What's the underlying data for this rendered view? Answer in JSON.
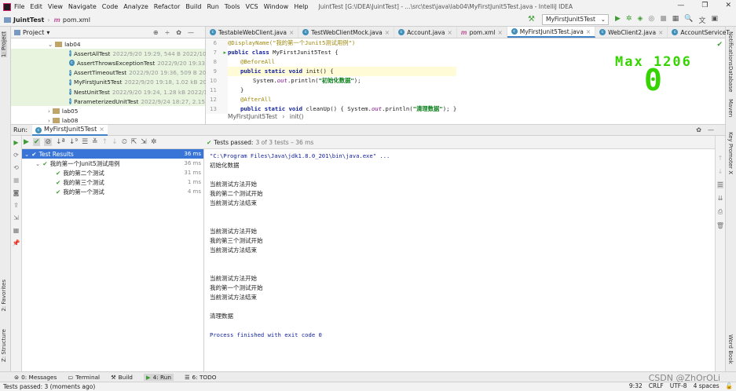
{
  "menubar": {
    "items": [
      "File",
      "Edit",
      "View",
      "Navigate",
      "Code",
      "Analyze",
      "Refactor",
      "Build",
      "Run",
      "Tools",
      "VCS",
      "Window",
      "Help"
    ],
    "title": "JuintTest [G:\\IDEA\\JuintTest] - ...\\src\\test\\java\\lab04\\MyFirstJunit5Test.java - IntelliJ IDEA"
  },
  "navbar": {
    "project": "JuintTest",
    "file": "pom.xml",
    "run_config": "MyFirstJunit5Test"
  },
  "left_tools": {
    "project": "1: Project",
    "favorites": "2: Favorites",
    "structure": "Z: Structure"
  },
  "right_tools": {
    "notifications": "Notifications",
    "database": "Database",
    "maven": "Maven",
    "key_promoter": "Key Promoter X",
    "word_book": "Word Book"
  },
  "project_panel": {
    "header": "Project",
    "rows": [
      {
        "type": "folder",
        "label": "lab04",
        "meta": ""
      },
      {
        "type": "class",
        "label": "AssertAllTest",
        "meta": "2022/9/20 19:29, 544 B 2022/10"
      },
      {
        "type": "class",
        "label": "AssertThrowsExceptionTest",
        "meta": "2022/9/20 19:33"
      },
      {
        "type": "class",
        "label": "AssertTimeoutTest",
        "meta": "2022/9/20 19:36, 509 B 20"
      },
      {
        "type": "class",
        "label": "MyFirstJunit5Test",
        "meta": "2022/9/20 19:18, 1.02 kB 20"
      },
      {
        "type": "class",
        "label": "NestUnitTest",
        "meta": "2022/9/20 19:24, 1.28 kB 2022/10/25 19:26"
      },
      {
        "type": "class",
        "label": "ParameterizedUnitTest",
        "meta": "2022/9/24 18:27, 2.15"
      },
      {
        "type": "folder",
        "label": "lab05",
        "meta": ""
      },
      {
        "type": "folder",
        "label": "lab08",
        "meta": ""
      }
    ]
  },
  "editor": {
    "tabs": [
      "TestableWebClient.java",
      "TestWebClientMock.java",
      "Account.java",
      "pom.xml",
      "MyFirstJunit5Test.java",
      "WebClient2.java",
      "AccountServiceT"
    ],
    "tab_more": "≡4",
    "line_numbers": [
      "6",
      "7",
      "8",
      "9",
      "10",
      "11",
      "12",
      "13"
    ],
    "lines": {
      "l6": "@DisplayName(\"我的第一个Junit5测试用例\")",
      "l7a": "public class ",
      "l7b": "MyFirstJunit5Test {",
      "l8": "@BeforeAll",
      "l9a": "public static void ",
      "l9b": "init() {",
      "l10a": "System.",
      "l10b": "out",
      "l10c": ".println(",
      "l10d": "\"初始化数据\"",
      "l10e": ");",
      "l11": "}",
      "l12": "@AfterAll",
      "l13a": "public static void ",
      "l13b": "cleanUp() { System.",
      "l13c": "out",
      "l13d": ".println(",
      "l13e": "\"清理数据\"",
      "l13f": "); }"
    },
    "breadcrumb": {
      "cls": "MyFirstJunit5Test",
      "method": "init()"
    },
    "overlay_max": "Max 1206",
    "overlay_zero": "0"
  },
  "run": {
    "label": "Run:",
    "tab": "MyFirstJunit5Test",
    "status_bold": "Tests passed:",
    "status_rest": "3 of 3 tests – 36 ms",
    "results": [
      {
        "label": "Test Results",
        "time": "36 ms",
        "indent": 0
      },
      {
        "label": "我的第一个Junit5测试用例",
        "time": "36 ms",
        "indent": 1
      },
      {
        "label": "我的第二个测试",
        "time": "31 ms",
        "indent": 2
      },
      {
        "label": "我的第三个测试",
        "time": "1 ms",
        "indent": 2
      },
      {
        "label": "我的第一个测试",
        "time": "4 ms",
        "indent": 2
      }
    ],
    "console": [
      "\"C:\\Program Files\\Java\\jdk1.8.0_201\\bin\\java.exe\" ...",
      "初始化数据",
      "",
      "当前测试方法开始",
      "我的第二个测试开始",
      "当前测试方法结束",
      "",
      "",
      "当前测试方法开始",
      "我的第三个测试开始",
      "当前测试方法结束",
      "",
      "",
      "当前测试方法开始",
      "我的第一个测试开始",
      "当前测试方法结束",
      "",
      "清理数据",
      "",
      "Process finished with exit code 0"
    ]
  },
  "bottom_tabs": [
    "0: Messages",
    "Terminal",
    "Build",
    "4: Run",
    "6: TODO"
  ],
  "statusbar": {
    "message": "Tests passed: 3 (moments ago)",
    "position": "9:32",
    "line_sep": "CRLF",
    "encoding": "UTF-8",
    "indent": "4 spaces"
  },
  "watermark": "CSDN @ZhOrOLi",
  "colors": {
    "accent": "#4083c9",
    "success": "#3f9c35",
    "selection": "#3875d7",
    "overlay": "#35d400"
  }
}
